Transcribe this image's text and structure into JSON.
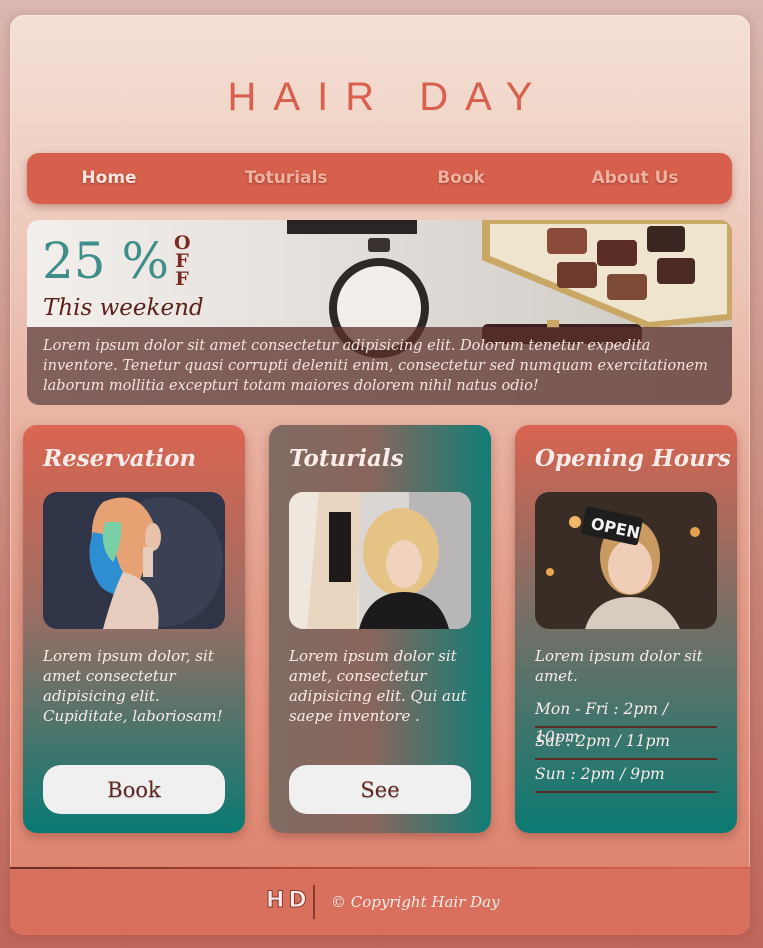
{
  "brand": {
    "title": "HAIR DAY"
  },
  "nav": {
    "items": [
      "Home",
      "Toturials",
      "Book",
      "About Us"
    ],
    "active": "Home"
  },
  "promo": {
    "discount": "25 %",
    "off_label": [
      "O",
      "F",
      "F"
    ],
    "subtitle": "This weekend",
    "description": "Lorem ipsum dolor sit amet consectetur adipisicing elit. Dolorum tenetur expedita inventore. Tenetur quasi corrupti deleniti enim, consectetur sed numquam exercitationem laborum mollitia excepturi totam maiores dolorem nihil natus odio!"
  },
  "cards": [
    {
      "title": "Reservation",
      "text": "Lorem ipsum dolor, sit amet consectetur adipisicing elit. Cupiditate, laboriosam!",
      "button": "Book"
    },
    {
      "title": "Toturials",
      "text": "Lorem ipsum dolor sit amet, consectetur adipisicing elit. Qui aut saepe inventore .",
      "button": "See"
    },
    {
      "title": "Opening Hours",
      "text": "Lorem ipsum dolor sit amet.",
      "hours": [
        "Mon - Fri : 2pm / 10pm",
        "Sat : 2pm / 11pm",
        "Sun : 2pm / 9pm"
      ]
    }
  ],
  "footer": {
    "logo": "HD",
    "copyright": "© Copyright Hair Day"
  },
  "colors": {
    "accent": "#d6604c",
    "teal": "#0a7a72",
    "dark_text": "#5a2019"
  }
}
